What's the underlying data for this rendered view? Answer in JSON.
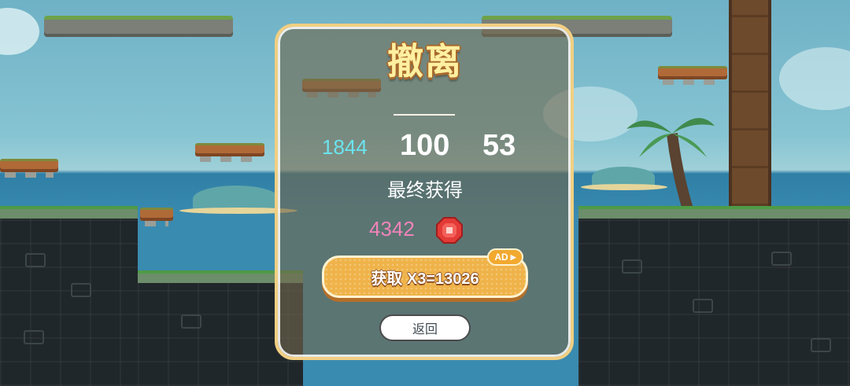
{
  "dialog": {
    "title": "撤离",
    "stats": {
      "left_value": "1844",
      "middle_value": "100",
      "right_value": "53"
    },
    "final_label": "最终获得",
    "reward": {
      "value": "4342",
      "icon": "red-gem-icon"
    },
    "ad_button": {
      "label": "获取 X3=13026",
      "badge": "AD"
    },
    "back_button": {
      "label": "返回"
    }
  },
  "colors": {
    "title": "#fff0a0",
    "stat_cyan": "#6ce3ee",
    "reward_pink": "#f184b9",
    "ad_button": "#efb34a",
    "modal_border": "#f1cf82"
  }
}
